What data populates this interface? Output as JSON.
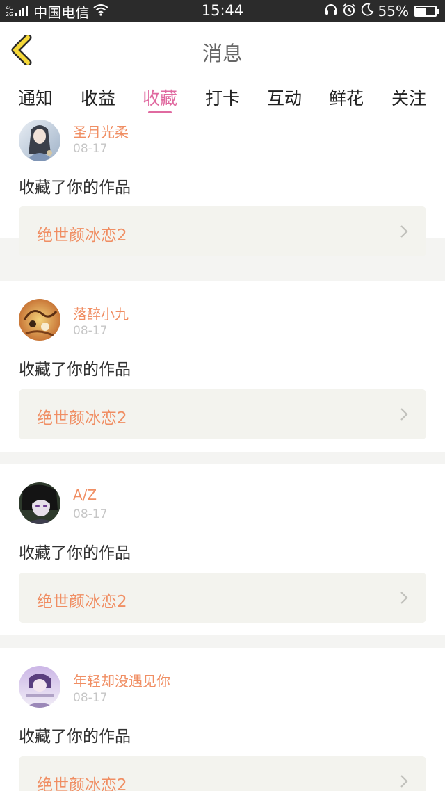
{
  "status_bar": {
    "network_top": "4G",
    "network_bottom": "2G",
    "carrier": "中国电信",
    "time": "15:44",
    "battery_percent": "55%",
    "battery_level": 0.55,
    "icons": [
      "signal-icon",
      "wifi-icon",
      "headset-icon",
      "alarm-icon",
      "moon-icon",
      "battery-icon"
    ]
  },
  "header": {
    "title": "消息",
    "back_icon": "chevron-left-icon",
    "accent_color": "#f5d838"
  },
  "tabs": [
    {
      "label": "通知"
    },
    {
      "label": "收益"
    },
    {
      "label": "收藏",
      "active": true
    },
    {
      "label": "打卡"
    },
    {
      "label": "互动"
    },
    {
      "label": "鲜花"
    },
    {
      "label": "关注"
    }
  ],
  "colors": {
    "active_tab": "#e06aa0",
    "username": "#f08e63",
    "work_title": "#f08e63",
    "date": "#c6c6c6",
    "card_box": "#f3f3ee"
  },
  "messages": [
    {
      "username": "圣月光柔",
      "date": "08-17",
      "action": "收藏了你的作品",
      "work_title": "绝世颜冰恋2",
      "chevron_icon": "chevron-right-icon"
    },
    {
      "username": "落醉小九",
      "date": "08-17",
      "action": "收藏了你的作品",
      "work_title": "绝世颜冰恋2",
      "chevron_icon": "chevron-right-icon"
    },
    {
      "username": "A/Z",
      "date": "08-17",
      "action": "收藏了你的作品",
      "work_title": "绝世颜冰恋2",
      "chevron_icon": "chevron-right-icon"
    },
    {
      "username": "年轻却没遇见你",
      "date": "08-17",
      "action": "收藏了你的作品",
      "work_title": "绝世颜冰恋2",
      "chevron_icon": "chevron-right-icon"
    }
  ]
}
